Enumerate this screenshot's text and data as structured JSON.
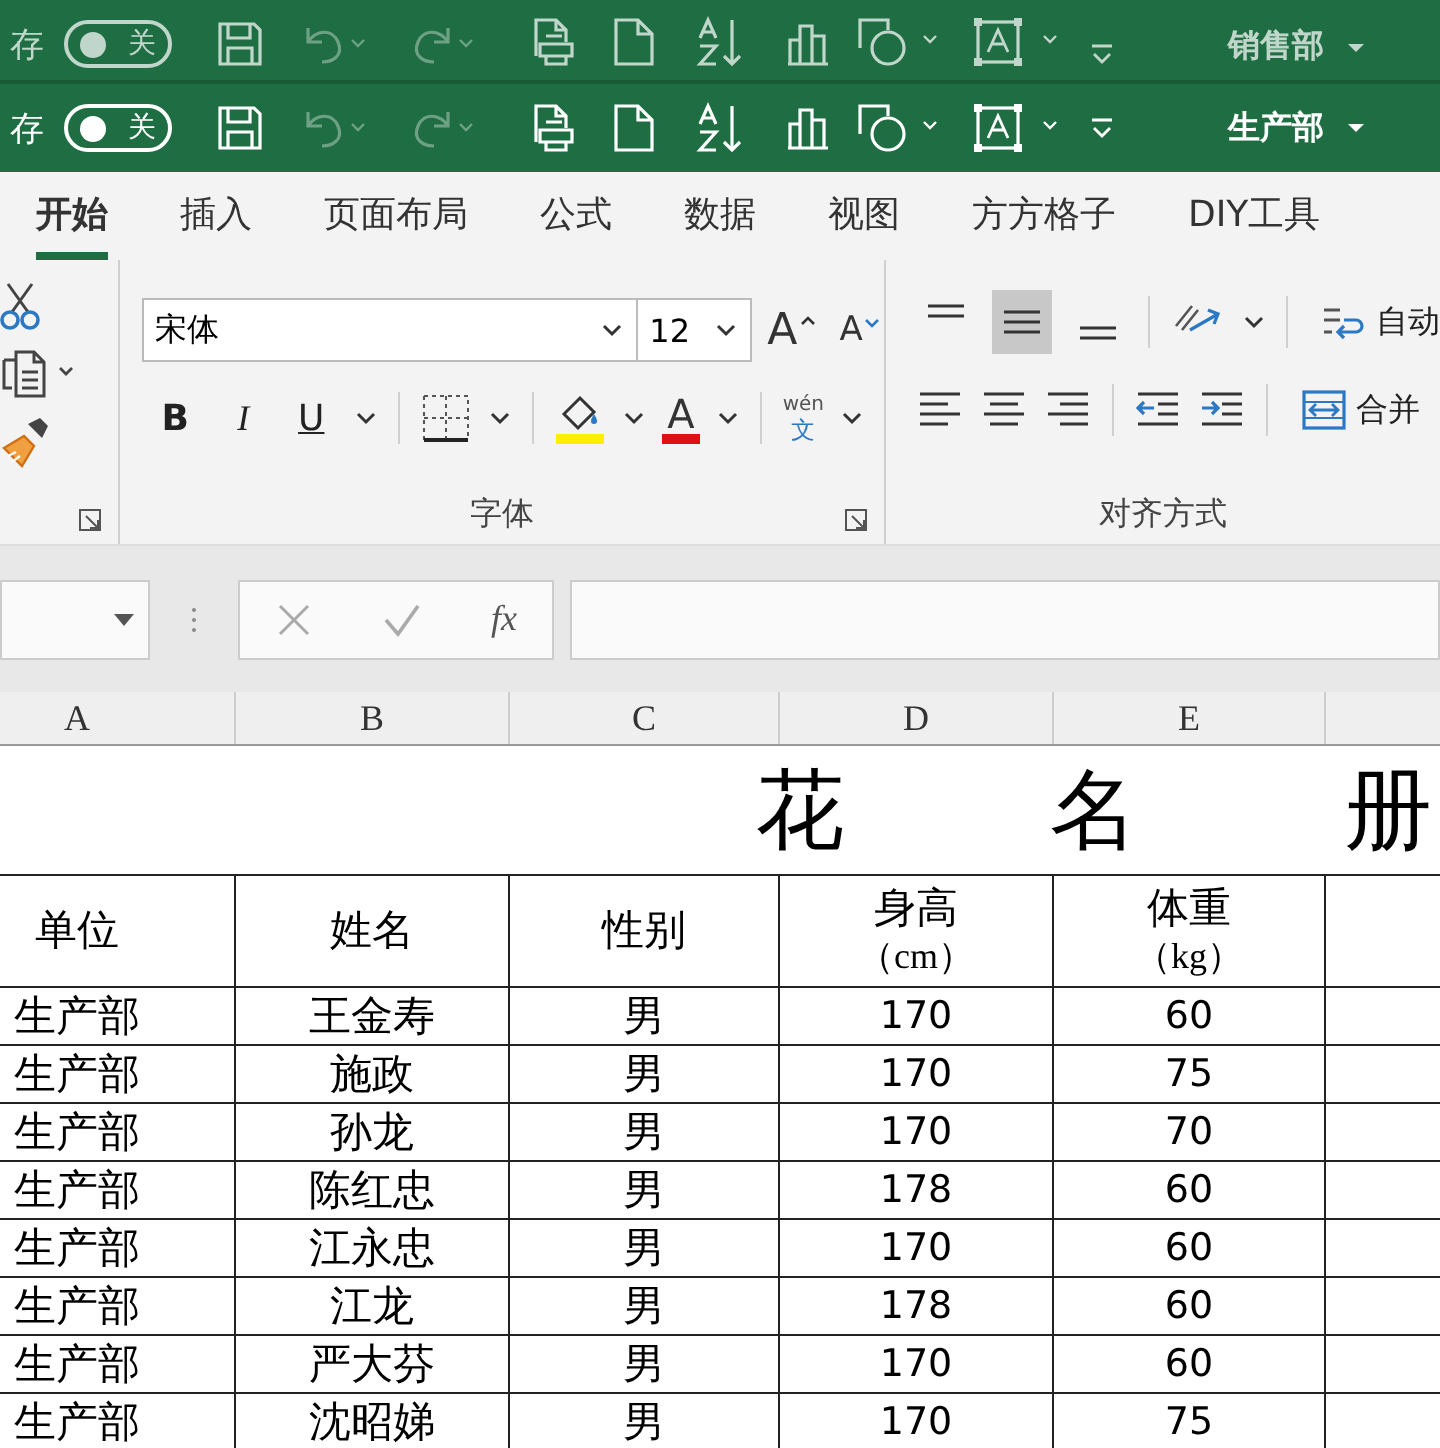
{
  "quick_access_bars": [
    {
      "faded": true,
      "autosave_label": "存",
      "toggle": {
        "label": "关",
        "on": false
      },
      "undo": {
        "disabled": true
      },
      "redo": {
        "disabled": true
      },
      "department": "销售部"
    },
    {
      "faded": false,
      "autosave_label": "存",
      "toggle": {
        "label": "关",
        "on": false
      },
      "undo": {
        "disabled": true
      },
      "redo": {
        "disabled": true
      },
      "department": "生产部"
    }
  ],
  "tabs": [
    {
      "label": "开始",
      "selected": true
    },
    {
      "label": "插入",
      "selected": false
    },
    {
      "label": "页面布局",
      "selected": false
    },
    {
      "label": "公式",
      "selected": false
    },
    {
      "label": "数据",
      "selected": false
    },
    {
      "label": "视图",
      "selected": false
    },
    {
      "label": "方方格子",
      "selected": false
    },
    {
      "label": "DIY工具",
      "selected": false
    }
  ],
  "ribbon": {
    "font_group": {
      "font_name": "宋体",
      "font_size": "12",
      "grow_font": "A",
      "shrink_font": "A",
      "bold": "B",
      "italic": "I",
      "underline": "U",
      "font_color": "A",
      "phonetic_top": "wén",
      "phonetic_bottom": "文",
      "label": "字体"
    },
    "alignment_group": {
      "vertical_align": [
        {
          "kind": "top",
          "selected": false
        },
        {
          "kind": "middle",
          "selected": true
        },
        {
          "kind": "bottom",
          "selected": false
        }
      ],
      "wrap_label": "自动",
      "merge_label": "合并",
      "label": "对齐方式"
    }
  },
  "formula_bar": {
    "function_label": "fx"
  },
  "sheet": {
    "column_headers": [
      "A",
      "B",
      "C",
      "D",
      "E"
    ],
    "title": "花 名 册",
    "header": [
      [
        "单位"
      ],
      [
        "姓名"
      ],
      [
        "性别"
      ],
      [
        "身高",
        "（cm）"
      ],
      [
        "体重",
        "（kg）"
      ]
    ],
    "rows": [
      [
        "生产部",
        "王金寿",
        "男",
        "170",
        "60"
      ],
      [
        "生产部",
        "施政",
        "男",
        "170",
        "75"
      ],
      [
        "生产部",
        "孙龙",
        "男",
        "170",
        "70"
      ],
      [
        "生产部",
        "陈红忠",
        "男",
        "178",
        "60"
      ],
      [
        "生产部",
        "江永忠",
        "男",
        "170",
        "60"
      ],
      [
        "生产部",
        "江龙",
        "男",
        "178",
        "60"
      ],
      [
        "生产部",
        "严大芬",
        "男",
        "170",
        "60"
      ],
      [
        "生产部",
        "沈昭娣",
        "男",
        "170",
        "75"
      ]
    ]
  }
}
